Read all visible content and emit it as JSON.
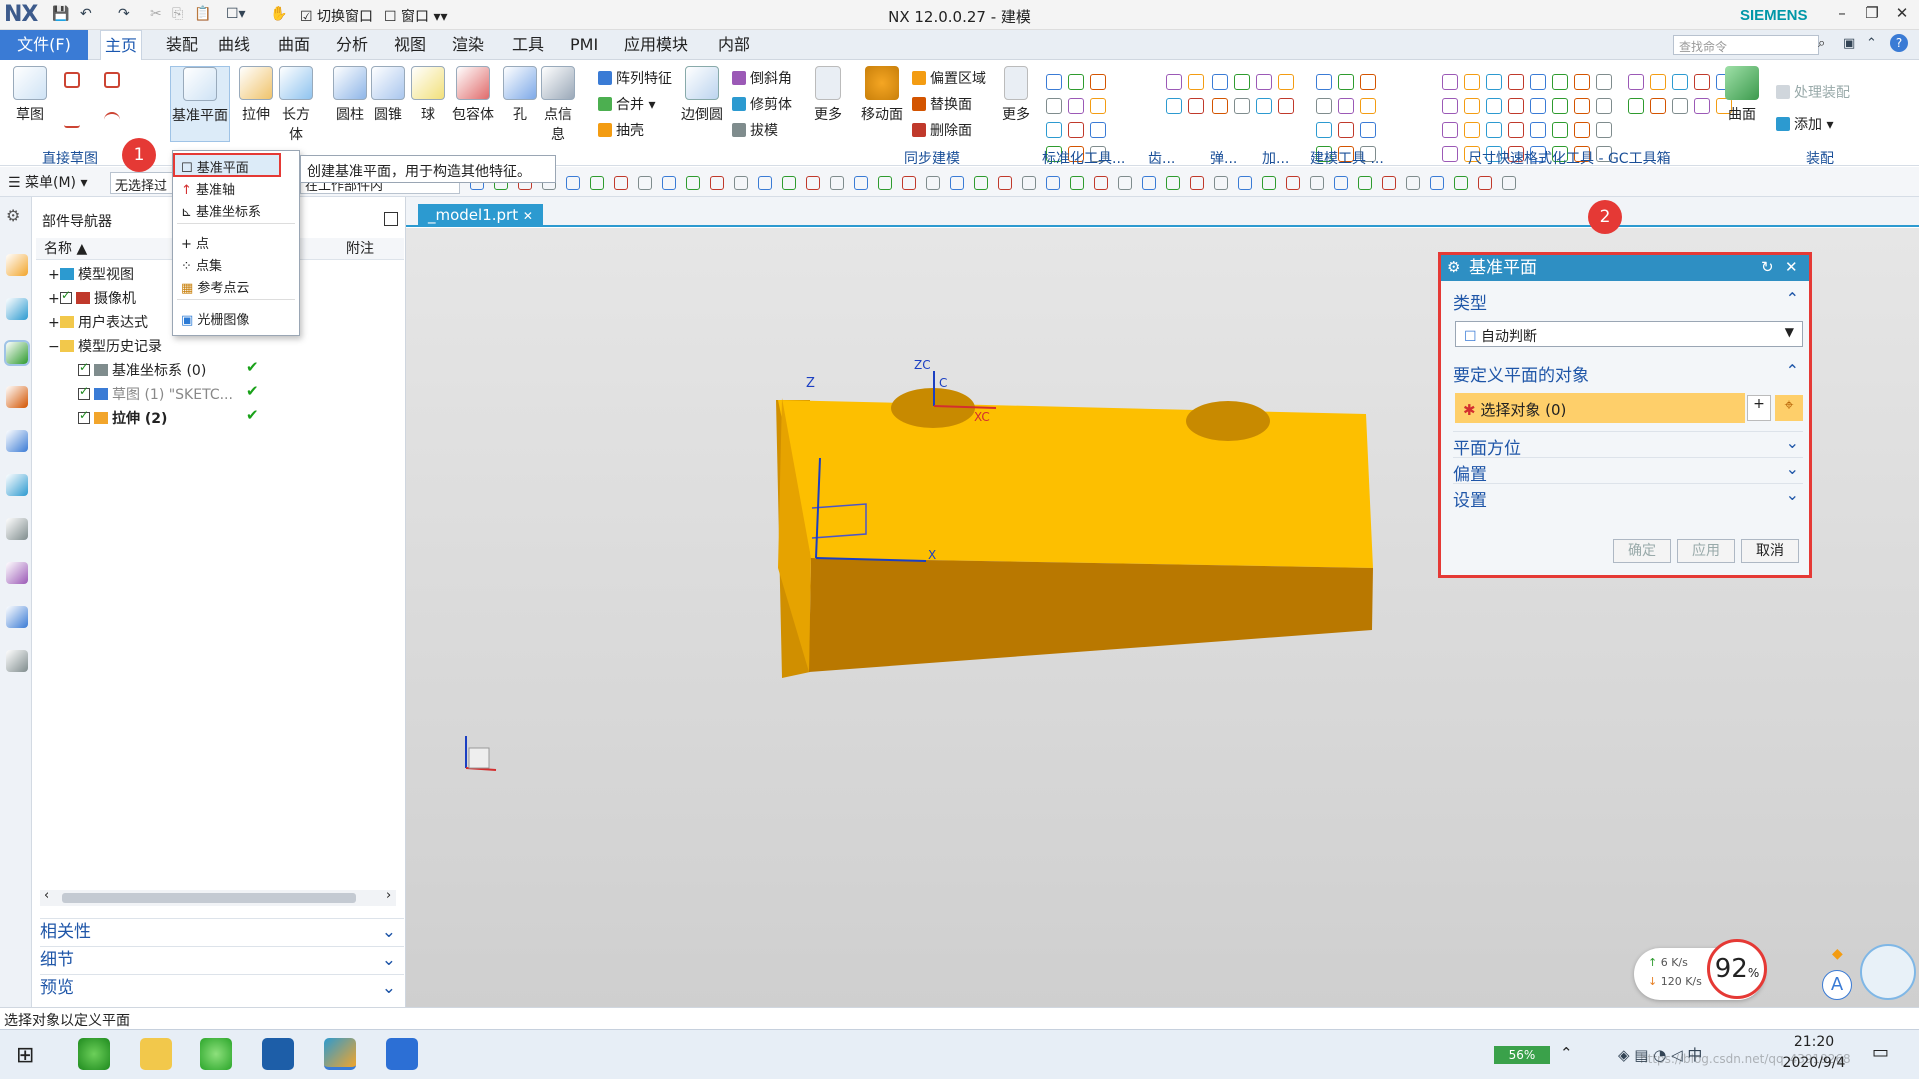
{
  "titlebar": {
    "logo": "NX",
    "title": "NX 12.0.0.27 - 建模",
    "brand": "SIEMENS",
    "switch_window": "切换窗口",
    "window_menu": "窗口"
  },
  "menubar": {
    "file": "文件(F)",
    "tabs": [
      "主页",
      "装配",
      "曲线",
      "曲面",
      "分析",
      "视图",
      "渲染",
      "工具",
      "PMI",
      "应用模块",
      "内部"
    ],
    "search_placeholder": "查找命令"
  },
  "ribbon": {
    "sketch": "草图",
    "main": [
      {
        "label": "基准平面",
        "icon": "datum-plane-icon"
      },
      {
        "label": "拉伸",
        "icon": "extrude-icon"
      },
      {
        "label": "长方体",
        "icon": "block-icon"
      },
      {
        "label": "圆柱",
        "icon": "cylinder-icon"
      },
      {
        "label": "圆锥",
        "icon": "cone-icon"
      },
      {
        "label": "球",
        "icon": "sphere-icon"
      },
      {
        "label": "包容体",
        "icon": "bounding-body-icon"
      },
      {
        "label": "孔",
        "icon": "hole-icon"
      },
      {
        "label": "点信息",
        "icon": "point-info-icon"
      }
    ],
    "small1": [
      "阵列特征",
      "合并",
      "抽壳"
    ],
    "edge_blend": "边倒圆",
    "small2": [
      "倒斜角",
      "修剪体",
      "拔模"
    ],
    "more": "更多",
    "move_face": "移动面",
    "small3": [
      "偏置区域",
      "替换面",
      "删除面"
    ],
    "more2": "更多",
    "surface": "曲面",
    "add": "添加",
    "process_assembly": "处理装配",
    "groups": [
      "直接草图",
      "同步建模",
      "标准化工具...",
      "齿...",
      "弹...",
      "加...",
      "建模工具 ...",
      "尺寸快速格式化工具 - GC工具箱",
      "装配"
    ]
  },
  "selection_bar": {
    "menu": "菜单(M)",
    "filter": "无选择过",
    "scope": "在工作部件内"
  },
  "dropdown": {
    "items": [
      "基准平面",
      "基准轴",
      "基准坐标系",
      "点",
      "点集",
      "参考点云",
      "光栅图像"
    ],
    "tooltip": "创建基准平面，用于构造其他特征。"
  },
  "badges": [
    "1",
    "2"
  ],
  "navigator": {
    "title": "部件导航器",
    "columns": [
      "名称",
      "附注"
    ],
    "nodes": [
      {
        "label": "模型视图"
      },
      {
        "label": "摄像机"
      },
      {
        "label": "用户表达式"
      },
      {
        "label": "模型历史记录"
      },
      {
        "label": "基准坐标系 (0)"
      },
      {
        "label": "草图 (1) \"SKETC..."
      },
      {
        "label": "拉伸 (2)"
      }
    ],
    "sections": [
      "相关性",
      "细节",
      "预览"
    ]
  },
  "document": {
    "tab": "_model1.prt"
  },
  "viewport": {
    "axes": [
      "Z",
      "ZC",
      "XC",
      "X",
      "C"
    ]
  },
  "dialog": {
    "title": "基准平面",
    "type_label": "类型",
    "type_value": "自动判断",
    "objects_label": "要定义平面的对象",
    "select_object": "选择对象 (0)",
    "sections": [
      "平面方位",
      "偏置",
      "设置"
    ],
    "buttons": {
      "ok": "确定",
      "apply": "应用",
      "cancel": "取消"
    }
  },
  "statusbar": {
    "message": "选择对象以定义平面"
  },
  "net_widget": {
    "upload": "6  K/s",
    "download": "120 K/s",
    "percent": "92",
    "unit": "%"
  },
  "taskbar": {
    "battery": "56%",
    "time": "21:20",
    "date": "2020/9/4",
    "watermark": "https://blog.csdn.net/qq_43919268"
  },
  "colors": {
    "accent": "#2c9ad0",
    "highlight": "#e53935",
    "part": "#fdbf00"
  }
}
